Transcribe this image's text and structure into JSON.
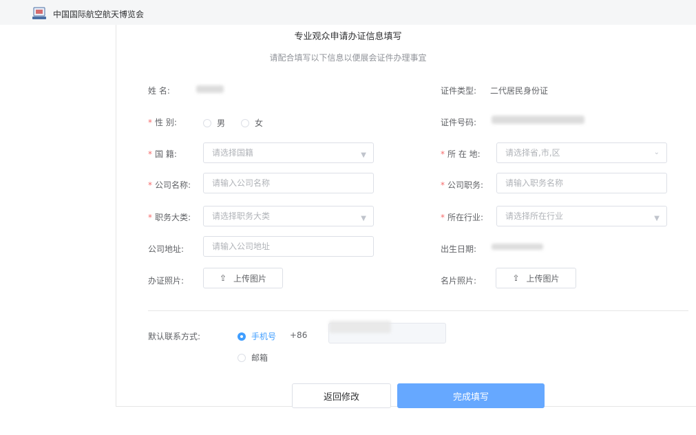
{
  "app": {
    "title": "中国国际航空航天博览会",
    "logo_icon": "app-logo-icon"
  },
  "form": {
    "title": "专业观众申请办证信息填写",
    "subtitle": "请配合填写以下信息以便展会证件办理事宜"
  },
  "fields": {
    "name": {
      "label": "姓 名:"
    },
    "id_type": {
      "label": "证件类型:",
      "value": "二代居民身份证"
    },
    "gender": {
      "label": "性 别:",
      "options": [
        "男",
        "女"
      ]
    },
    "id_number": {
      "label": "证件号码:"
    },
    "nationality": {
      "label": "国 籍:",
      "placeholder": "请选择国籍"
    },
    "location": {
      "label": "所 在 地:",
      "placeholder": "请选择省,市,区"
    },
    "company_name": {
      "label": "公司名称:",
      "placeholder": "请输入公司名称"
    },
    "position": {
      "label": "公司职务:",
      "placeholder": "请输入职务名称"
    },
    "job_category": {
      "label": "职务大类:",
      "placeholder": "请选择职务大类"
    },
    "industry": {
      "label": "所在行业:",
      "placeholder": "请选择所在行业"
    },
    "company_address": {
      "label": "公司地址:",
      "placeholder": "请输入公司地址"
    },
    "birth_date": {
      "label": "出生日期:"
    },
    "id_photo": {
      "label": "办证照片:",
      "button": "上传图片"
    },
    "card_photo": {
      "label": "名片照片:",
      "button": "上传图片"
    }
  },
  "contact": {
    "label": "默认联系方式:",
    "options": [
      "手机号",
      "邮箱"
    ],
    "selected": "手机号",
    "country_code": "+86"
  },
  "buttons": {
    "back": "返回修改",
    "done": "完成填写"
  },
  "colors": {
    "accent": "#409eff",
    "primary_button": "#66a8ff",
    "required": "#f56c6c"
  }
}
